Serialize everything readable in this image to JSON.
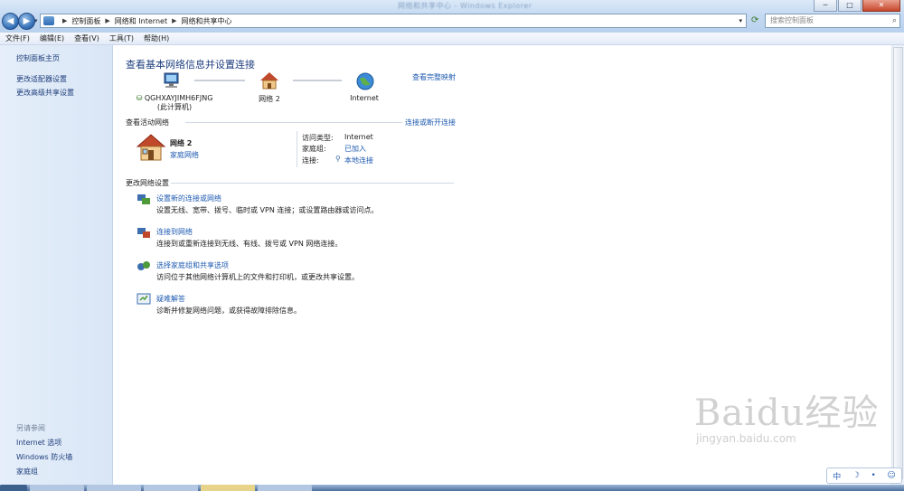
{
  "window": {
    "title": "网络和共享中心 - Windows Explorer",
    "controls": {
      "minimize": "─",
      "maximize": "□",
      "close": "✕"
    }
  },
  "nav": {
    "back": "◀",
    "forward": "▶",
    "dropdown": "▾"
  },
  "address": {
    "crumbs": [
      "控制面板",
      "网络和 Internet",
      "网络和共享中心"
    ],
    "sep": "▶",
    "dropdown": "▾"
  },
  "search": {
    "placeholder": "搜索控制面板"
  },
  "menu": [
    "文件(F)",
    "编辑(E)",
    "查看(V)",
    "工具(T)",
    "帮助(H)"
  ],
  "sidebar": {
    "items": [
      "控制面板主页",
      "更改适配器设置",
      "更改高级共享设置"
    ],
    "see_also_title": "另请参阅",
    "see_also": [
      "Internet 选项",
      "Windows 防火墙",
      "家庭组"
    ]
  },
  "main": {
    "title": "查看基本网络信息并设置连接",
    "full_map_link": "查看完整映射",
    "map": {
      "computer_name": "QGHXAYJIMH6FJNG",
      "computer_sub": "(此计算机)",
      "network": "网络  2",
      "internet": "Internet"
    },
    "active_header": "查看活动网络",
    "connect_link": "连接或断开连接",
    "network": {
      "name": "网络  2",
      "type": "家庭网络",
      "access_label": "访问类型:",
      "access_value": "Internet",
      "homegroup_label": "家庭组:",
      "homegroup_value": "已加入",
      "conn_label": "连接:",
      "conn_value": "本地连接"
    },
    "change_header": "更改网络设置",
    "tasks": [
      {
        "title": "设置新的连接或网络",
        "desc": "设置无线、宽带、拨号、临时或 VPN 连接；或设置路由器或访问点。"
      },
      {
        "title": "连接到网络",
        "desc": "连接到或重新连接到无线、有线、拨号或 VPN 网络连接。"
      },
      {
        "title": "选择家庭组和共享选项",
        "desc": "访问位于其他网络计算机上的文件和打印机，或更改共享设置。"
      },
      {
        "title": "疑难解答",
        "desc": "诊断并修复网络问题，或获得故障排除信息。"
      }
    ]
  },
  "watermark": {
    "main": "Baidu经验",
    "sub": "jingyan.baidu.com"
  },
  "ime": {
    "label": "中"
  },
  "colors": {
    "link": "#1e5ab0",
    "title": "#1f3f7f",
    "sidebar_bg": "#dce8f7"
  }
}
